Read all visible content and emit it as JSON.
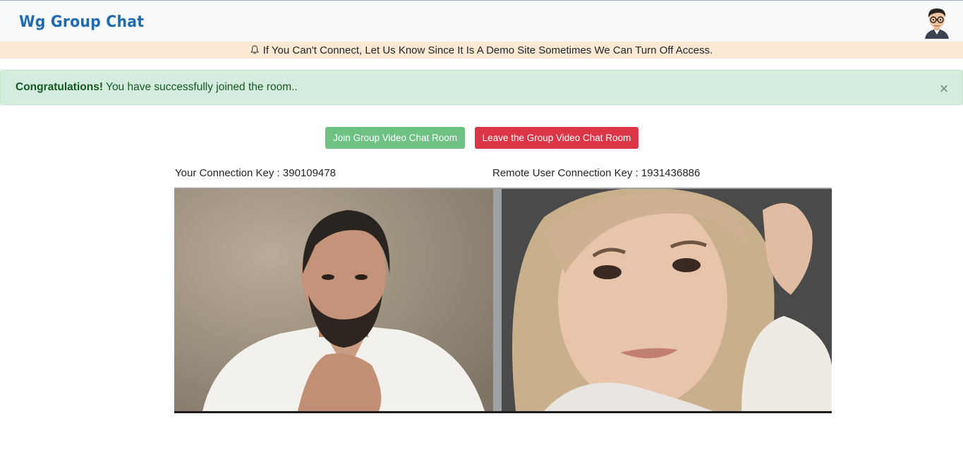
{
  "header": {
    "brand": "Wg Group Chat",
    "avatar_icon": "user-avatar-icon"
  },
  "notice": {
    "icon": "bell-icon",
    "text": "If You Can't Connect, Let Us Know Since It Is A Demo Site Sometimes We Can Turn Off Access."
  },
  "alert": {
    "strong": "Congratulations!",
    "text": " You have successfully joined the room..",
    "close": "×"
  },
  "actions": {
    "join_label": "Join Group Video Chat Room",
    "leave_label": "Leave the Group Video Chat Room"
  },
  "connection": {
    "local_key": "Your Connection Key : 390109478",
    "remote_key": "Remote User Connection Key : 1931436886"
  },
  "colors": {
    "brand": "#1e6bb0",
    "notice_bg": "#fbe9d4",
    "alert_bg": "#d4ecdd",
    "join": "#6cc183",
    "leave": "#dc3545"
  }
}
